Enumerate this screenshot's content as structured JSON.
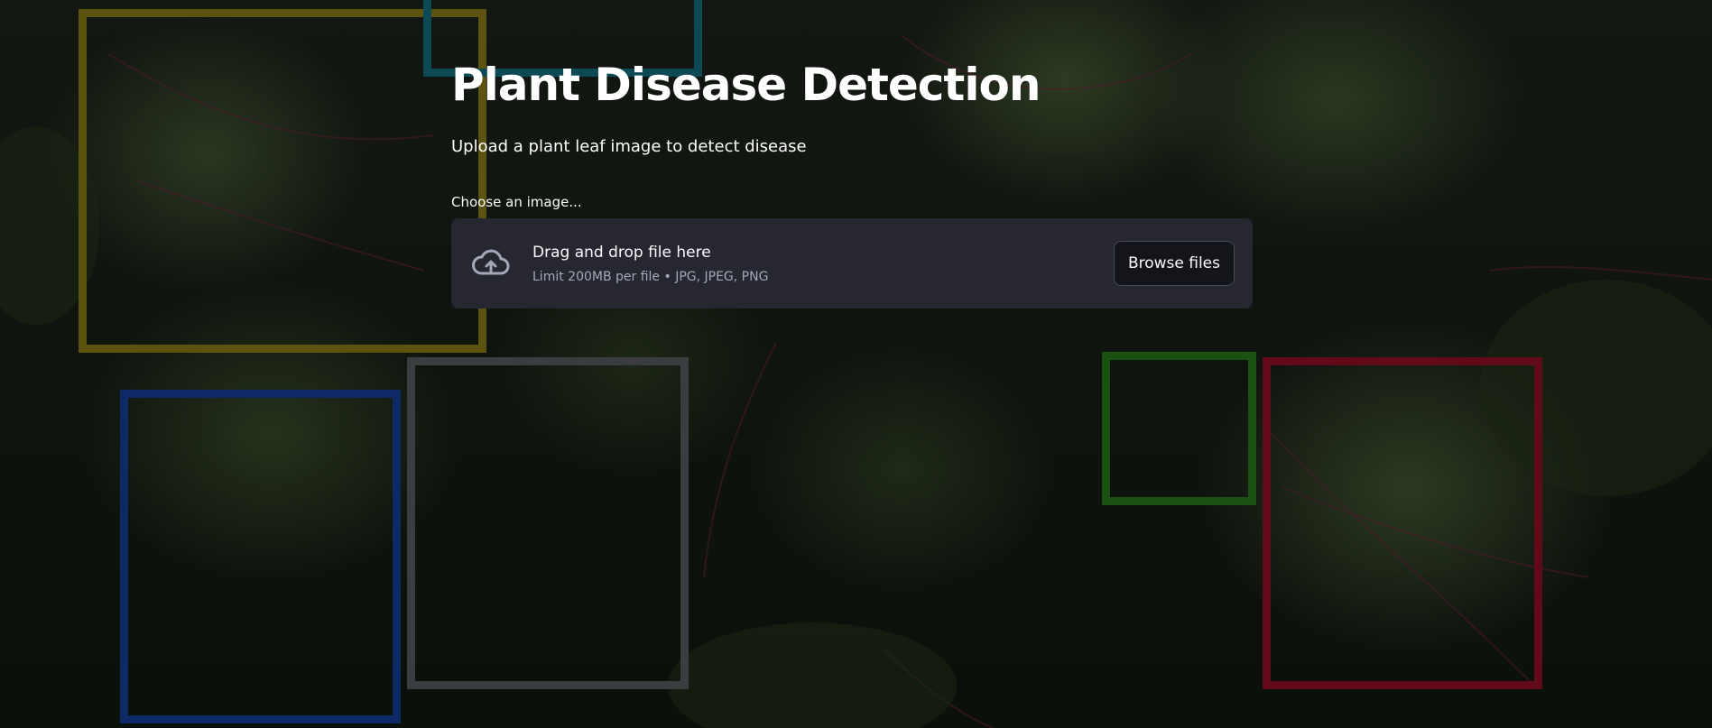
{
  "app": {
    "title": "Plant Disease Detection",
    "subtitle": "Upload a plant leaf image to detect disease"
  },
  "uploader": {
    "label": "Choose an image...",
    "drop_title": "Drag and drop file here",
    "limit_text": "Limit 200MB per file • JPG, JPEG, PNG",
    "browse_label": "Browse files",
    "icon": "cloud-upload-icon"
  },
  "colors": {
    "background_leaf": "#2b3721",
    "dropzone_bg": "#262730",
    "button_bg": "#13151a",
    "text": "#fafafa",
    "muted_text": "#a3a8b8"
  },
  "decorations": {
    "frames": [
      {
        "name": "yellow-frame",
        "color": "#5d5311"
      },
      {
        "name": "teal-frame",
        "color": "#0e4a55"
      },
      {
        "name": "blue-frame",
        "color": "#0d2a66"
      },
      {
        "name": "gray-frame",
        "color": "#3b3d40"
      },
      {
        "name": "green-frame",
        "color": "#1b5110"
      },
      {
        "name": "red-frame",
        "color": "#62091a"
      }
    ]
  }
}
